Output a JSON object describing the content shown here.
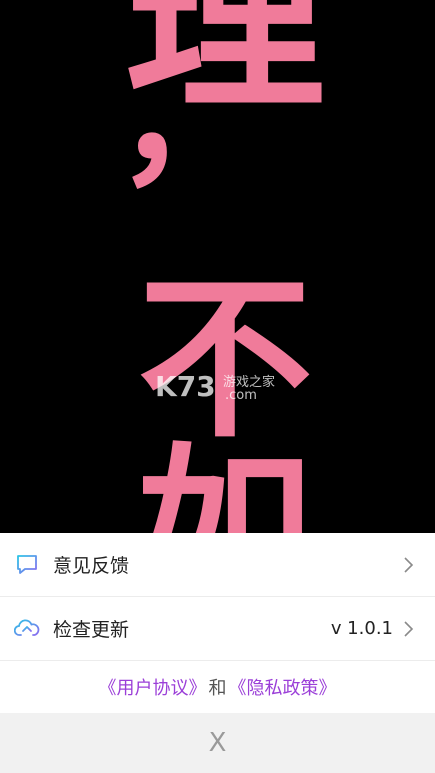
{
  "hero": {
    "glyphs": [
      "理",
      "，",
      "不",
      "如"
    ],
    "text_color": "#f07b9a",
    "watermark_brand": "K73",
    "watermark_site": "游戏之家",
    "watermark_domain": ".com"
  },
  "menu": {
    "feedback_label": "意见反馈",
    "update_label": "检查更新",
    "version": "v 1.0.1"
  },
  "policy": {
    "user_agreement": "《用户协议》",
    "and": "和",
    "privacy_policy": "《隐私政策》"
  },
  "close_label": "X",
  "colors": {
    "accent_purple": "#9b3fd8",
    "icon_cyan": "#2bc4e6",
    "icon_purple": "#8b6cf0"
  }
}
